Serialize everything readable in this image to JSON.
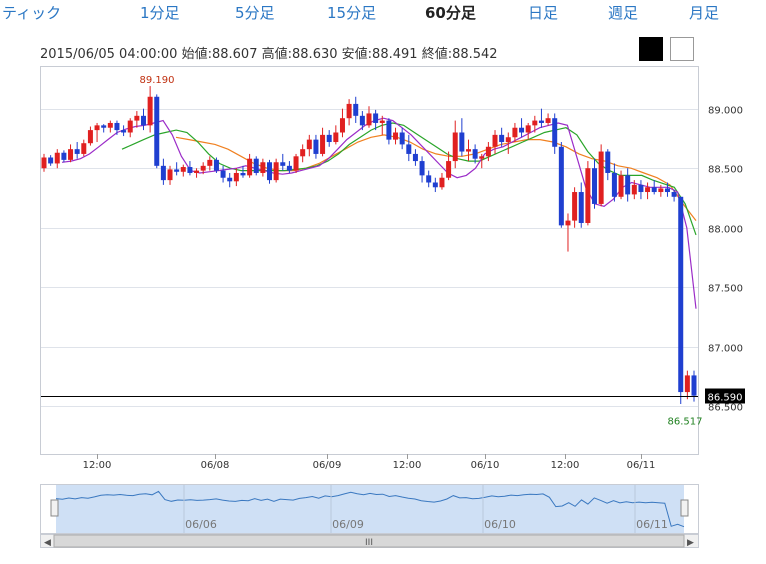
{
  "tabs": [
    {
      "label": "ティック",
      "active": false
    },
    {
      "label": "1分足",
      "active": false
    },
    {
      "label": "5分足",
      "active": false
    },
    {
      "label": "15分足",
      "active": false
    },
    {
      "label": "60分足",
      "active": true
    },
    {
      "label": "日足",
      "active": false
    },
    {
      "label": "週足",
      "active": false
    },
    {
      "label": "月足",
      "active": false
    }
  ],
  "info": {
    "datetime": "2015/06/05 04:00:00",
    "open_label": "始値:",
    "open": "88.607",
    "high_label": "高値:",
    "high": "88.630",
    "low_label": "安値:",
    "low": "88.491",
    "close_label": "終値:",
    "close": "88.542"
  },
  "theme_buttons": {
    "dark": "dark-theme",
    "light": "light-theme"
  },
  "colors": {
    "up": "#e02020",
    "down": "#1f3fd0",
    "ma_short": "#9b2cc8",
    "ma_mid": "#2aa52a",
    "ma_long": "#f08020",
    "grid": "#dfe3ea",
    "nav_fill": "#cfe0f5",
    "nav_line": "#3a78c0"
  },
  "chart_data": {
    "type": "candlestick",
    "series": [
      {
        "name": "",
        "type": "candlestick"
      },
      {
        "name": "",
        "type": "line"
      },
      {
        "name": "",
        "type": "line"
      },
      {
        "name": "",
        "type": "line"
      }
    ],
    "ylim": [
      86.1,
      89.35
    ],
    "y_ticks": [
      "89.000",
      "88.500",
      "88.000",
      "87.500",
      "87.000",
      "86.500"
    ],
    "y_tick_values": [
      89.0,
      88.5,
      88.0,
      87.5,
      87.0,
      86.5
    ],
    "x_ticks": [
      "12:00",
      "06/08",
      "06/09",
      "12:00",
      "06/10",
      "12:00",
      "06/11"
    ],
    "max_label": "89.190",
    "min_label": "86.517",
    "current_price": "86.590",
    "current_value": 86.59,
    "navigator_ticks": [
      "06/06",
      "06/09",
      "06/10",
      "06/11"
    ],
    "scrollbar_label": "III",
    "candles": [
      [
        88.5,
        88.62,
        88.47,
        88.59
      ],
      [
        88.59,
        88.61,
        88.52,
        88.54
      ],
      [
        88.54,
        88.66,
        88.5,
        88.63
      ],
      [
        88.63,
        88.65,
        88.55,
        88.57
      ],
      [
        88.57,
        88.7,
        88.55,
        88.66
      ],
      [
        88.66,
        88.72,
        88.58,
        88.62
      ],
      [
        88.62,
        88.74,
        88.6,
        88.71
      ],
      [
        88.71,
        88.85,
        88.69,
        88.82
      ],
      [
        88.82,
        88.88,
        88.72,
        88.86
      ],
      [
        88.86,
        88.87,
        88.8,
        88.84
      ],
      [
        88.84,
        88.9,
        88.8,
        88.88
      ],
      [
        88.88,
        88.9,
        88.78,
        88.82
      ],
      [
        88.82,
        88.86,
        88.77,
        88.8
      ],
      [
        88.8,
        88.92,
        88.76,
        88.9
      ],
      [
        88.9,
        88.98,
        88.84,
        88.94
      ],
      [
        88.94,
        89.0,
        88.82,
        88.86
      ],
      [
        88.86,
        89.19,
        88.8,
        89.1
      ],
      [
        89.1,
        89.12,
        88.5,
        88.52
      ],
      [
        88.52,
        88.58,
        88.36,
        88.4
      ],
      [
        88.4,
        88.52,
        88.36,
        88.49
      ],
      [
        88.49,
        88.55,
        88.44,
        88.47
      ],
      [
        88.47,
        88.53,
        88.43,
        88.51
      ],
      [
        88.51,
        88.56,
        88.44,
        88.46
      ],
      [
        88.46,
        88.5,
        88.42,
        88.48
      ],
      [
        88.48,
        88.55,
        88.45,
        88.52
      ],
      [
        88.52,
        88.6,
        88.48,
        88.57
      ],
      [
        88.57,
        88.59,
        88.46,
        88.48
      ],
      [
        88.48,
        88.52,
        88.38,
        88.42
      ],
      [
        88.42,
        88.46,
        88.34,
        88.39
      ],
      [
        88.39,
        88.5,
        88.35,
        88.46
      ],
      [
        88.46,
        88.52,
        88.42,
        88.44
      ],
      [
        88.44,
        88.62,
        88.42,
        88.58
      ],
      [
        88.58,
        88.6,
        88.44,
        88.46
      ],
      [
        88.46,
        88.58,
        88.43,
        88.55
      ],
      [
        88.55,
        88.57,
        88.37,
        88.4
      ],
      [
        88.4,
        88.58,
        88.38,
        88.55
      ],
      [
        88.55,
        88.62,
        88.48,
        88.52
      ],
      [
        88.52,
        88.56,
        88.46,
        88.48
      ],
      [
        88.48,
        88.62,
        88.46,
        88.6
      ],
      [
        88.6,
        88.7,
        88.55,
        88.66
      ],
      [
        88.66,
        88.78,
        88.6,
        88.74
      ],
      [
        88.74,
        88.78,
        88.58,
        88.62
      ],
      [
        88.62,
        88.84,
        88.6,
        88.78
      ],
      [
        88.78,
        88.82,
        88.68,
        88.72
      ],
      [
        88.72,
        88.86,
        88.7,
        88.8
      ],
      [
        88.8,
        89.0,
        88.76,
        88.92
      ],
      [
        88.92,
        89.08,
        88.86,
        89.04
      ],
      [
        89.04,
        89.1,
        88.88,
        88.94
      ],
      [
        88.94,
        88.98,
        88.82,
        88.86
      ],
      [
        88.86,
        89.02,
        88.84,
        88.96
      ],
      [
        88.96,
        88.99,
        88.82,
        88.88
      ],
      [
        88.88,
        88.94,
        88.78,
        88.9
      ],
      [
        88.9,
        88.92,
        88.7,
        88.74
      ],
      [
        88.74,
        88.84,
        88.7,
        88.8
      ],
      [
        88.8,
        88.84,
        88.66,
        88.7
      ],
      [
        88.7,
        88.78,
        88.56,
        88.62
      ],
      [
        88.62,
        88.66,
        88.52,
        88.56
      ],
      [
        88.56,
        88.6,
        88.38,
        88.44
      ],
      [
        88.44,
        88.48,
        88.34,
        88.38
      ],
      [
        88.38,
        88.42,
        88.3,
        88.34
      ],
      [
        88.34,
        88.46,
        88.32,
        88.42
      ],
      [
        88.42,
        88.64,
        88.4,
        88.56
      ],
      [
        88.56,
        88.9,
        88.5,
        88.8
      ],
      [
        88.8,
        88.92,
        88.6,
        88.64
      ],
      [
        88.64,
        88.74,
        88.56,
        88.66
      ],
      [
        88.66,
        88.7,
        88.54,
        88.58
      ],
      [
        88.58,
        88.62,
        88.5,
        88.6
      ],
      [
        88.6,
        88.72,
        88.56,
        88.68
      ],
      [
        88.68,
        88.82,
        88.62,
        88.78
      ],
      [
        88.78,
        88.84,
        88.68,
        88.72
      ],
      [
        88.72,
        88.8,
        88.62,
        88.76
      ],
      [
        88.76,
        88.88,
        88.72,
        88.84
      ],
      [
        88.84,
        88.92,
        88.76,
        88.8
      ],
      [
        88.8,
        88.88,
        88.74,
        88.86
      ],
      [
        88.86,
        88.94,
        88.8,
        88.9
      ],
      [
        88.9,
        89.0,
        88.84,
        88.88
      ],
      [
        88.88,
        88.96,
        88.86,
        88.92
      ],
      [
        88.92,
        88.96,
        88.62,
        88.68
      ],
      [
        88.68,
        88.72,
        88.0,
        88.02
      ],
      [
        88.02,
        88.12,
        87.8,
        88.06
      ],
      [
        88.06,
        88.34,
        88.0,
        88.3
      ],
      [
        88.3,
        88.38,
        88.0,
        88.04
      ],
      [
        88.04,
        88.56,
        88.02,
        88.5
      ],
      [
        88.5,
        88.58,
        88.16,
        88.2
      ],
      [
        88.2,
        88.7,
        88.18,
        88.64
      ],
      [
        88.64,
        88.66,
        88.4,
        88.46
      ],
      [
        88.46,
        88.54,
        88.22,
        88.26
      ],
      [
        88.26,
        88.48,
        88.24,
        88.44
      ],
      [
        88.44,
        88.5,
        88.22,
        88.28
      ],
      [
        88.28,
        88.4,
        88.24,
        88.36
      ],
      [
        88.36,
        88.4,
        88.24,
        88.3
      ],
      [
        88.3,
        88.38,
        88.24,
        88.34
      ],
      [
        88.34,
        88.4,
        88.28,
        88.3
      ],
      [
        88.3,
        88.36,
        88.26,
        88.33
      ],
      [
        88.33,
        88.38,
        88.26,
        88.3
      ],
      [
        88.3,
        88.32,
        88.22,
        88.26
      ],
      [
        88.26,
        86.85,
        86.52,
        86.62
      ],
      [
        86.62,
        86.8,
        86.56,
        86.76
      ],
      [
        86.76,
        86.8,
        86.54,
        86.59
      ]
    ],
    "ma_short": [
      88.55,
      88.56,
      88.58,
      88.62,
      88.68,
      88.74,
      88.8,
      88.83,
      88.85,
      88.86,
      88.88,
      88.9,
      88.78,
      88.6,
      88.48,
      88.46,
      88.47,
      88.48,
      88.49,
      88.5,
      88.52,
      88.5,
      88.48,
      88.46,
      88.45,
      88.46,
      88.48,
      88.5,
      88.52,
      88.58,
      88.66,
      88.74,
      88.8,
      88.86,
      88.9,
      88.92,
      88.9,
      88.84,
      88.78,
      88.7,
      88.62,
      88.54,
      88.46,
      88.42,
      88.44,
      88.5,
      88.62,
      88.66,
      88.68,
      88.72,
      88.76,
      88.8,
      88.84,
      88.86,
      88.88,
      88.86,
      88.6,
      88.34,
      88.2,
      88.18,
      88.24,
      88.34,
      88.38,
      88.36,
      88.34,
      88.34,
      88.34,
      88.3,
      88.0,
      87.32
    ],
    "ma_mid": [
      88.66,
      88.7,
      88.74,
      88.78,
      88.8,
      88.82,
      88.8,
      88.72,
      88.62,
      88.54,
      88.5,
      88.48,
      88.48,
      88.48,
      88.48,
      88.48,
      88.49,
      88.5,
      88.52,
      88.56,
      88.62,
      88.7,
      88.76,
      88.82,
      88.86,
      88.88,
      88.86,
      88.8,
      88.74,
      88.68,
      88.62,
      88.58,
      88.56,
      88.56,
      88.6,
      88.64,
      88.68,
      88.72,
      88.76,
      88.8,
      88.82,
      88.84,
      88.78,
      88.64,
      88.54,
      88.48,
      88.44,
      88.44,
      88.44,
      88.4,
      88.37,
      88.34,
      88.2,
      87.94
    ],
    "ma_long": [
      88.76,
      88.74,
      88.72,
      88.7,
      88.66,
      88.6,
      88.54,
      88.5,
      88.48,
      88.48,
      88.5,
      88.54,
      88.6,
      88.66,
      88.72,
      88.76,
      88.78,
      88.76,
      88.72,
      88.66,
      88.62,
      88.6,
      88.6,
      88.62,
      88.66,
      88.7,
      88.72,
      88.74,
      88.74,
      88.72,
      88.68,
      88.62,
      88.58,
      88.56,
      88.52,
      88.5,
      88.46,
      88.42,
      88.36,
      88.2,
      88.06
    ]
  }
}
